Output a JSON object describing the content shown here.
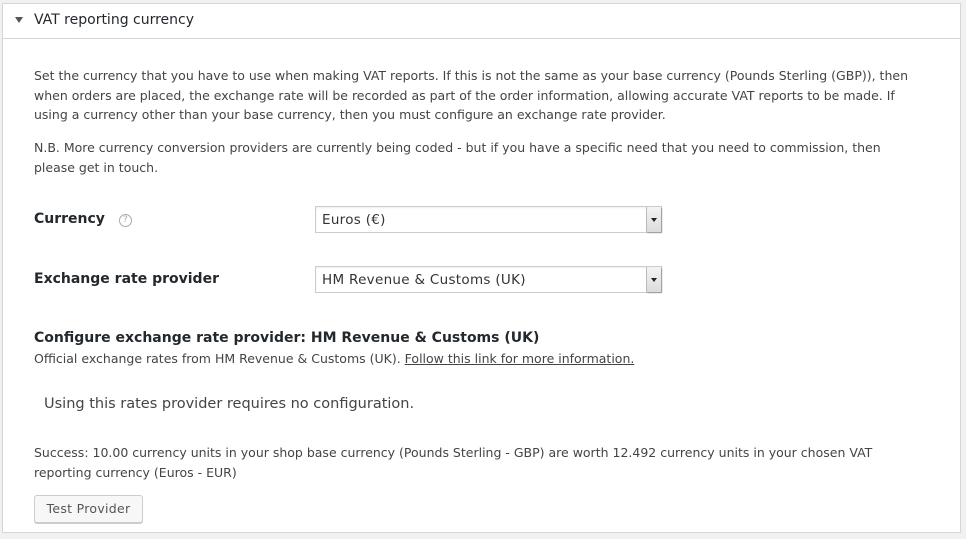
{
  "panel": {
    "title": "VAT reporting currency"
  },
  "intro": {
    "paragraph1": "Set the currency that you have to use when making VAT reports. If this is not the same as your base currency (Pounds Sterling (GBP)), then when orders are placed, the exchange rate will be recorded as part of the order information, allowing accurate VAT reports to be made. If using a currency other than your base currency, then you must configure an exchange rate provider.",
    "paragraph2": "N.B. More currency conversion providers are currently being coded - but if you have a specific need that you need to commission, then please get in touch."
  },
  "currency": {
    "label": "Currency",
    "help_icon": "?",
    "selected": "Euros (€)"
  },
  "provider": {
    "label": "Exchange rate provider",
    "selected": "HM Revenue & Customs (UK)"
  },
  "configure": {
    "heading": "Configure exchange rate provider: HM Revenue & Customs (UK)",
    "description": "Official exchange rates from HM Revenue & Customs (UK).",
    "link_text": "Follow this link for more information.",
    "no_config_text": "Using this rates provider requires no configuration.",
    "success_text": "Success: 10.00 currency units in your shop base currency (Pounds Sterling - GBP) are worth 12.492 currency units in your chosen VAT reporting currency (Euros - EUR)",
    "test_button_label": "Test Provider"
  }
}
